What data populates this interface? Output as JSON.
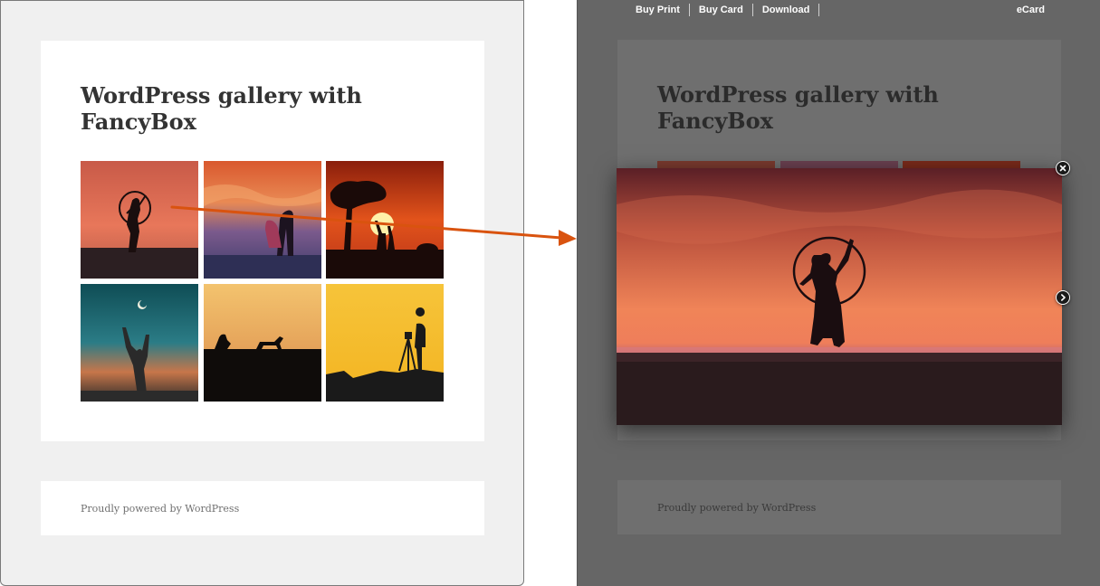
{
  "page": {
    "title": "WordPress gallery with FancyBox",
    "footer_text": "Proudly powered by WordPress"
  },
  "gallery": {
    "items": [
      {
        "icon": "hula-hoop-dancer-sunset-photo"
      },
      {
        "icon": "couple-kissing-sunset-photo"
      },
      {
        "icon": "savanna-giraffes-sunset-photo"
      },
      {
        "icon": "person-reaching-moon-photo"
      },
      {
        "icon": "dog-and-person-silhouette-photo"
      },
      {
        "icon": "photographer-tripod-silhouette-photo"
      }
    ]
  },
  "lightbox": {
    "toolbar": {
      "links": [
        "Buy Print",
        "Buy Card",
        "Download"
      ],
      "ecard": "eCard"
    },
    "image_icon": "hula-hoop-dancer-sunset-photo",
    "close_icon": "close-icon",
    "next_icon": "chevron-right-icon"
  },
  "colors": {
    "arrow": "#d9530f",
    "overlay": "#666666",
    "page_bg": "#f0f0f0"
  }
}
